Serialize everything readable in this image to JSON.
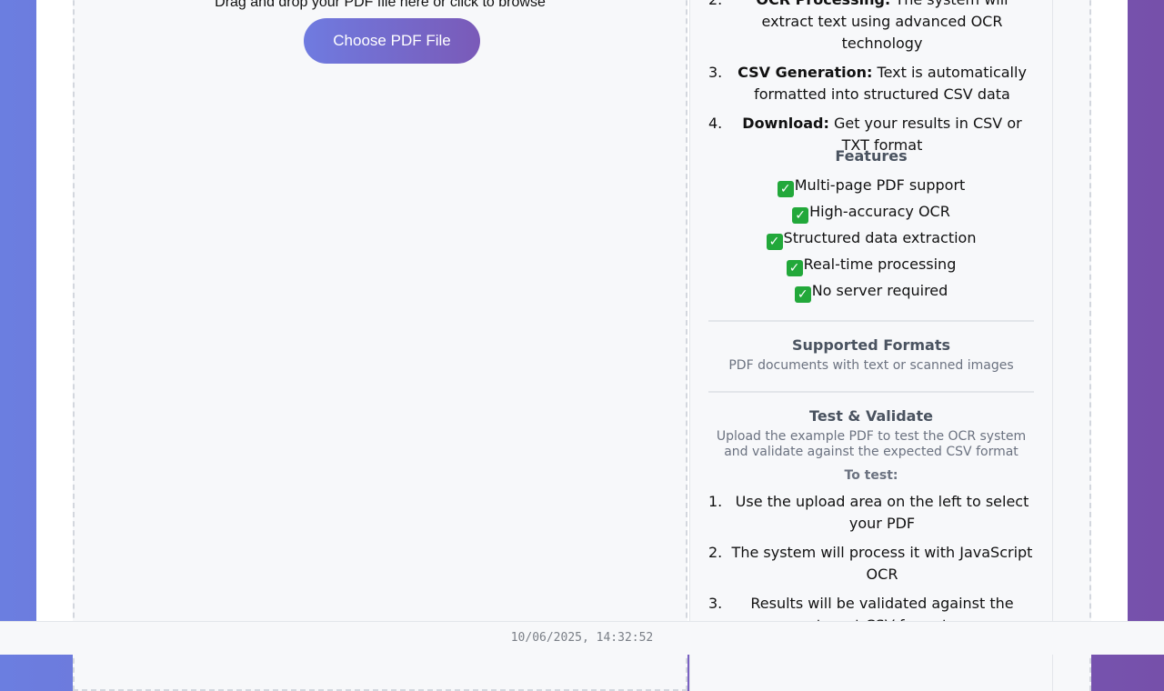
{
  "upload": {
    "drag_text": "Drag and drop your PDF file here or click to browse",
    "button_label": "Choose PDF File"
  },
  "how_it_works": {
    "steps": [
      {
        "num": "2.",
        "title": "OCR Processing:",
        "text": "The system will extract text using advanced OCR technology"
      },
      {
        "num": "3.",
        "title": "CSV Generation:",
        "text": "Text is automatically formatted into structured CSV data"
      },
      {
        "num": "4.",
        "title": "Download:",
        "text": "Get your results in CSV or TXT format"
      }
    ]
  },
  "features": {
    "title": "Features",
    "items": [
      "Multi-page PDF support",
      "High-accuracy OCR",
      "Structured data extraction",
      "Real-time processing",
      "No server required"
    ],
    "check_glyph": "✓"
  },
  "supported_formats": {
    "title": "Supported Formats",
    "text": "PDF documents with text or scanned images"
  },
  "test_validate": {
    "title": "Test & Validate",
    "text": "Upload the example PDF to test the OCR system and validate against the expected CSV format",
    "to_test_label": "To test:",
    "steps": [
      {
        "num": "1.",
        "text": "Use the upload area on the left to select your PDF"
      },
      {
        "num": "2.",
        "text": "The system will process it with JavaScript OCR"
      },
      {
        "num": "3.",
        "text": "Results will be validated against the target CSV format"
      }
    ]
  },
  "footer": {
    "timestamp": "10/06/2025, 14:32:52"
  },
  "colors": {
    "accent_start": "#6f7be0",
    "accent_end": "#7a5ab8",
    "check_green": "#22a83a"
  }
}
